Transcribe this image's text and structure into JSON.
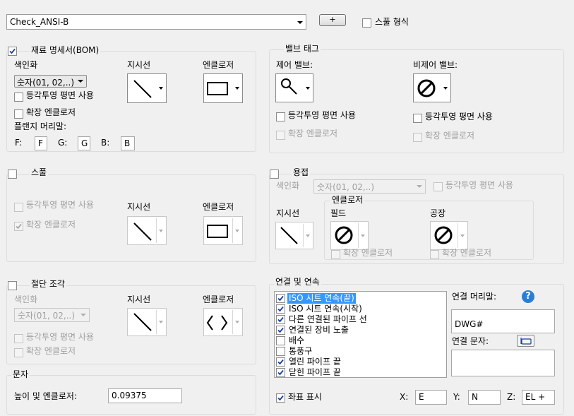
{
  "top": {
    "spec_value": "Check_ANSI-B",
    "plus_label": "+",
    "spool_format_label": "스풀 형식"
  },
  "bom": {
    "title": "재료 명세서(BOM)",
    "indexing_label": "색인화",
    "indexing_value": "숫자(01, 02,..)",
    "isometric_label": "등각투영 평면 사용",
    "extended_label": "확장 엔클로저",
    "leader_label": "지시선",
    "enclosure_label": "엔클로저",
    "flange_prefix_label": "플랜지 머리말:",
    "f_label": "F:",
    "f_value": "F",
    "g_label": "G:",
    "g_value": "G",
    "b_label": "B:",
    "b_value": "B"
  },
  "valve": {
    "title": "밸브 태그",
    "control_label": "제어 밸브:",
    "non_control_label": "비제어 밸브:",
    "isometric_label": "등각투영 평면 사용",
    "extended_label": "확장 엔클로저"
  },
  "spool": {
    "title": "스풀",
    "isometric_label": "등각투영 평면 사용",
    "extended_label": "확장 엔클로저",
    "leader_label": "지시선",
    "enclosure_label": "엔클로저"
  },
  "weld": {
    "title": "용접",
    "indexing_label": "색인화",
    "indexing_value": "숫자(01, 02,..)",
    "isometric_label": "등각투영 평면 사용",
    "leader_label": "지시선",
    "enclosure_group": "엔클로저",
    "field_label": "필드",
    "shop_label": "공장",
    "extended_label": "확장 엔클로저"
  },
  "cut": {
    "title": "절단 조각",
    "indexing_label": "색인화",
    "indexing_value": "숫자(01, 02,..)",
    "isometric_label": "등각투영 평면 사용",
    "extended_label": "확장 엔클로저",
    "leader_label": "지시선",
    "enclosure_label": "엔클로저"
  },
  "text": {
    "title": "문자",
    "height_label": "높이 및 엔클로저:",
    "height_value": "0.09375"
  },
  "conn": {
    "title": "연결 및 연속",
    "items": [
      {
        "label": "ISO 시트 연속(끝)",
        "checked": true
      },
      {
        "label": "ISO 시트 연속(시작)",
        "checked": true
      },
      {
        "label": "다른 연결된 파이프 선",
        "checked": true
      },
      {
        "label": "연결된 장비 노출",
        "checked": true
      },
      {
        "label": "배수",
        "checked": false
      },
      {
        "label": "통풍구",
        "checked": false
      },
      {
        "label": "열린 파이프 끝",
        "checked": true
      },
      {
        "label": "닫힌 파이프 끝",
        "checked": true
      }
    ],
    "prefix_label": "연결 머리말:",
    "prefix_value": "DWG#",
    "text_label": "연결 문자:",
    "help_label": "?",
    "coords_label": "좌표 표시",
    "x_label": "X:",
    "x_value": "E",
    "y_label": "Y:",
    "y_value": "N",
    "z_label": "Z:",
    "z_value": "EL +"
  }
}
